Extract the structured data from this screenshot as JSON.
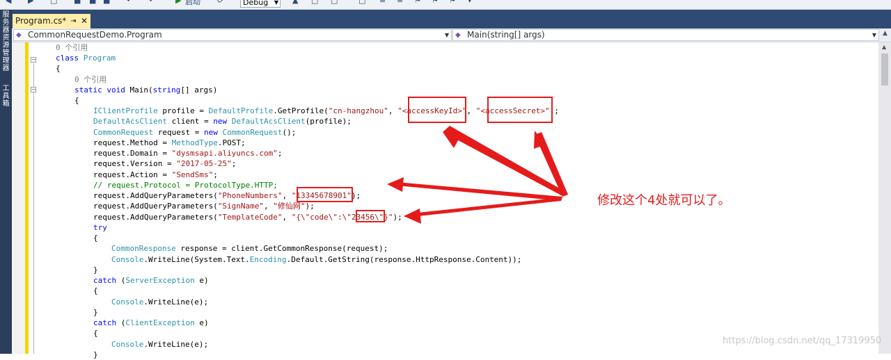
{
  "toolbar": {
    "config": "Debug",
    "start_label": "启动"
  },
  "side_rail": {
    "top_label": "服\n务\n器\n资\n源\n管\n理\n器",
    "bottom_label": "工\n具\n箱"
  },
  "tab": {
    "title": "Program.cs*",
    "pin": "⇥",
    "close": "✕"
  },
  "navigation": {
    "type_combo": "CommonRequestDemo.Program",
    "member_combo": "Main(string[] args)"
  },
  "code": {
    "refs_class": "0 个引用",
    "class_kw": "class",
    "class_name": "Program",
    "brace_open": "{",
    "brace_close": "}",
    "refs_method": "0 个引用",
    "kw_static": "static",
    "kw_void": "void",
    "main_sig": "Main(",
    "kw_string": "string",
    "main_args": "[] args)",
    "l1_type": "IClientProfile",
    "l1_a": " profile = ",
    "l1_type2": "DefaultProfile",
    "l1_b": ".GetProfile(",
    "l1_s1": "\"cn-hangzhou\"",
    "l1_c": ", ",
    "l1_s2": "\"<accessKeyId>\"",
    "l1_d": ", ",
    "l1_s3": "\"<accessSecret>\"",
    "l1_e": ");",
    "l2_type": "DefaultAcsClient",
    "l2_a": " client = ",
    "kw_new": "new",
    "l2_type2": "DefaultAcsClient",
    "l2_b": "(profile);",
    "l3_type": "CommonRequest",
    "l3_a": " request = ",
    "l3_type2": "CommonRequest",
    "l3_b": "();",
    "l4_a": "request.Method = ",
    "l4_type": "MethodType",
    "l4_b": ".POST;",
    "l5_a": "request.Domain = ",
    "l5_s": "\"dysmsapi.aliyuncs.com\"",
    "l5_b": ";",
    "l6_a": "request.Version = ",
    "l6_s": "\"2017-05-25\"",
    "l6_b": ";",
    "l7_a": "request.Action = ",
    "l7_s": "\"SendSms\"",
    "l7_b": ";",
    "l8_comment": "// request.Protocol = ProtocolType.HTTP;",
    "l9_a": "request.AddQueryParameters(",
    "l9_s1": "\"PhoneNumbers\"",
    "l9_b": ", ",
    "l9_s2": "\"13345678901\"",
    "l9_c": ");",
    "l10_a": "request.AddQueryParameters(",
    "l10_s1": "\"SignName\"",
    "l10_b": ", ",
    "l10_s2": "\"修仙网\"",
    "l10_c": ");",
    "l11_a": "request.AddQueryParameters(",
    "l11_s1": "\"TemplateCode\"",
    "l11_b": ", ",
    "l11_s2": "\"{\\\"code\\\":\\\"23456\\\"}\"",
    "l11_c": ");",
    "kw_try": "try",
    "l12_type": "CommonResponse",
    "l12_a": " response = client.GetCommonResponse(request);",
    "l13_type": "Console",
    "l13_a": ".WriteLine(System.Text.",
    "l13_type2": "Encoding",
    "l13_b": ".Default.GetString(response.HttpResponse.Content));",
    "kw_catch": "catch",
    "catch1_a": " (",
    "catch1_type": "ServerException",
    "catch1_b": " e)",
    "l14_type": "Console",
    "l14_a": ".WriteLine(e);",
    "catch2_type": "ClientException",
    "l15_type": "Console",
    "l15_a": ".WriteLine(e);"
  },
  "annotation": "修改这个4处就可以了。",
  "watermark": "https://blog.csdn.net/qq_17319950",
  "colors": {
    "highlight": "#e51b1b",
    "keyword": "#0000ff",
    "type": "#2b91af",
    "string": "#a31515",
    "comment": "#008000"
  }
}
